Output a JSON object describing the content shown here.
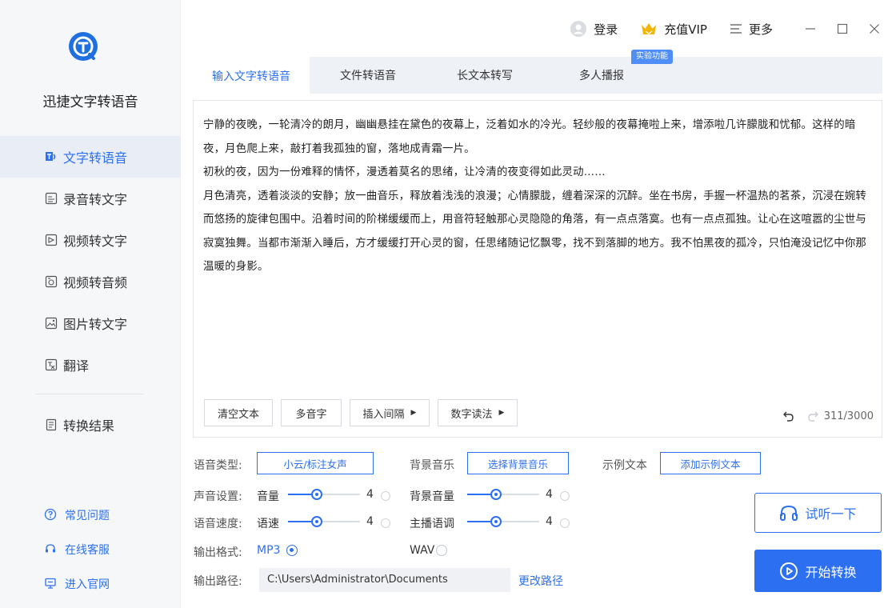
{
  "app": {
    "name": "迅捷文字转语音"
  },
  "sidebar": {
    "items": [
      {
        "label": "文字转语音",
        "icon": "text-to-speech-icon",
        "active": true
      },
      {
        "label": "录音转文字",
        "icon": "recording-to-text-icon"
      },
      {
        "label": "视频转文字",
        "icon": "video-to-text-icon"
      },
      {
        "label": "视频转音频",
        "icon": "video-to-audio-icon"
      },
      {
        "label": "图片转文字",
        "icon": "image-to-text-icon"
      },
      {
        "label": "翻译",
        "icon": "translate-icon"
      }
    ],
    "result": {
      "label": "转换结果",
      "icon": "document-icon"
    },
    "bottom": [
      {
        "label": "常见问题",
        "icon": "question-icon"
      },
      {
        "label": "在线客服",
        "icon": "headset-icon"
      },
      {
        "label": "进入官网",
        "icon": "monitor-icon"
      }
    ]
  },
  "topbar": {
    "login": "登录",
    "vip": "充值VIP",
    "more": "更多"
  },
  "tabs": [
    {
      "label": "输入文字转语音",
      "active": true
    },
    {
      "label": "文件转语音"
    },
    {
      "label": "长文本转写"
    },
    {
      "label": "多人播报"
    }
  ],
  "experimental_badge": "实验功能",
  "editor": {
    "paragraphs": [
      "宁静的夜晚，一轮清冷的朗月，幽幽悬挂在黛色的夜幕上，泛着如水的冷光。轻纱般的夜幕掩啦上来，增添啦几许朦胧和忧郁。这样的暗夜，月色爬上来，敲打着我孤独的窗，落地成青霜一片。",
      "初秋的夜，因为一份难释的情怀，漫透着莫名的思绪，让冷清的夜变得如此灵动……",
      "月色清亮，透着淡淡的安静；放一曲音乐，释放着浅浅的浪漫；心情朦胧，缠着深深的沉醉。坐在书房，手握一杯温热的茗茶，沉浸在婉转而悠扬的旋律包围中。沿着时间的阶梯缓缓而上，用音符轻触那心灵隐隐的角落，有一点点落寞。也有一点点孤独。让心在这喧嚣的尘世与寂寞独舞。当都市渐渐入睡后，方才缓缓打开心灵的窗，任思绪随记忆飘零，找不到落脚的地方。我不怕黑夜的孤冷，只怕淹没记忆中你那温暖的身影。"
    ],
    "buttons": {
      "clear": "清空文本",
      "polyphone": "多音字",
      "insert_pause": "插入间隔",
      "number_reading": "数字读法"
    },
    "char_count": "311/3000"
  },
  "settings": {
    "voice_type_label": "语音类型:",
    "voice_type_value": "小云/标注女声",
    "bg_music_label": "背景音乐",
    "bg_music_button": "选择背景音乐",
    "sample_text_label": "示例文本",
    "sample_text_button": "添加示例文本",
    "sound_settings_label": "声音设置:",
    "volume_label": "音量",
    "volume_value": "4",
    "volume_level": 0.4,
    "bg_volume_label": "背景音量",
    "bg_volume_value": "4",
    "bg_volume_level": 0.4,
    "speed_label_row": "语音速度:",
    "speed_label": "语速",
    "speed_value": "4",
    "speed_level": 0.4,
    "pitch_label": "主播语调",
    "pitch_value": "4",
    "pitch_level": 0.4,
    "format_label": "输出格式:",
    "format_mp3": "MP3",
    "format_wav": "WAV",
    "selected_format": "MP3",
    "path_label": "输出路径:",
    "path_value": "C:\\Users\\Administrator\\Documents",
    "change_path": "更改路径"
  },
  "actions": {
    "listen": "试听一下",
    "start": "开始转换"
  },
  "colors": {
    "accent": "#2c6ff0",
    "sidebar_bg": "#f6f7f9",
    "vip_gold": "#f5b400"
  }
}
